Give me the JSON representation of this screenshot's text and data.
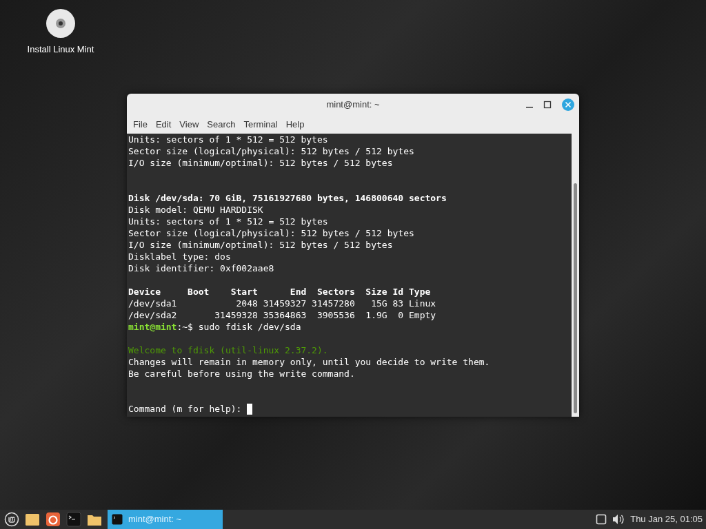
{
  "desktop_icons": [
    {
      "label": "Install Linux Mint"
    }
  ],
  "window": {
    "title": "mint@mint: ~",
    "menu": [
      "File",
      "Edit",
      "View",
      "Search",
      "Terminal",
      "Help"
    ],
    "terminal_lines": [
      {
        "kind": "normal",
        "text": "Units: sectors of 1 * 512 = 512 bytes"
      },
      {
        "kind": "normal",
        "text": "Sector size (logical/physical): 512 bytes / 512 bytes"
      },
      {
        "kind": "normal",
        "text": "I/O size (minimum/optimal): 512 bytes / 512 bytes"
      },
      {
        "kind": "blank"
      },
      {
        "kind": "blank"
      },
      {
        "kind": "bold",
        "text": "Disk /dev/sda: 70 GiB, 75161927680 bytes, 146800640 sectors"
      },
      {
        "kind": "normal",
        "text": "Disk model: QEMU HARDDISK"
      },
      {
        "kind": "normal",
        "text": "Units: sectors of 1 * 512 = 512 bytes"
      },
      {
        "kind": "normal",
        "text": "Sector size (logical/physical): 512 bytes / 512 bytes"
      },
      {
        "kind": "normal",
        "text": "I/O size (minimum/optimal): 512 bytes / 512 bytes"
      },
      {
        "kind": "normal",
        "text": "Disklabel type: dos"
      },
      {
        "kind": "normal",
        "text": "Disk identifier: 0xf002aae8"
      },
      {
        "kind": "blank"
      },
      {
        "kind": "bold",
        "text": "Device     Boot    Start      End  Sectors  Size Id Type"
      },
      {
        "kind": "normal",
        "text": "/dev/sda1           2048 31459327 31457280   15G 83 Linux"
      },
      {
        "kind": "normal",
        "text": "/dev/sda2       31459328 35364863  3905536  1.9G  0 Empty"
      },
      {
        "kind": "prompt",
        "user": "mint@mint",
        "path": ":~$",
        "text": " sudo fdisk /dev/sda"
      },
      {
        "kind": "blank"
      },
      {
        "kind": "welcome",
        "text": "Welcome to fdisk (util-linux 2.37.2)."
      },
      {
        "kind": "normal",
        "text": "Changes will remain in memory only, until you decide to write them."
      },
      {
        "kind": "normal",
        "text": "Be careful before using the write command."
      },
      {
        "kind": "blank"
      },
      {
        "kind": "blank"
      },
      {
        "kind": "input",
        "text": "Command (m for help): "
      }
    ]
  },
  "taskbar": {
    "window_buttons": [
      {
        "label": "mint@mint: ~",
        "selected": true
      }
    ],
    "clock": "Thu Jan 25, 01:05"
  }
}
